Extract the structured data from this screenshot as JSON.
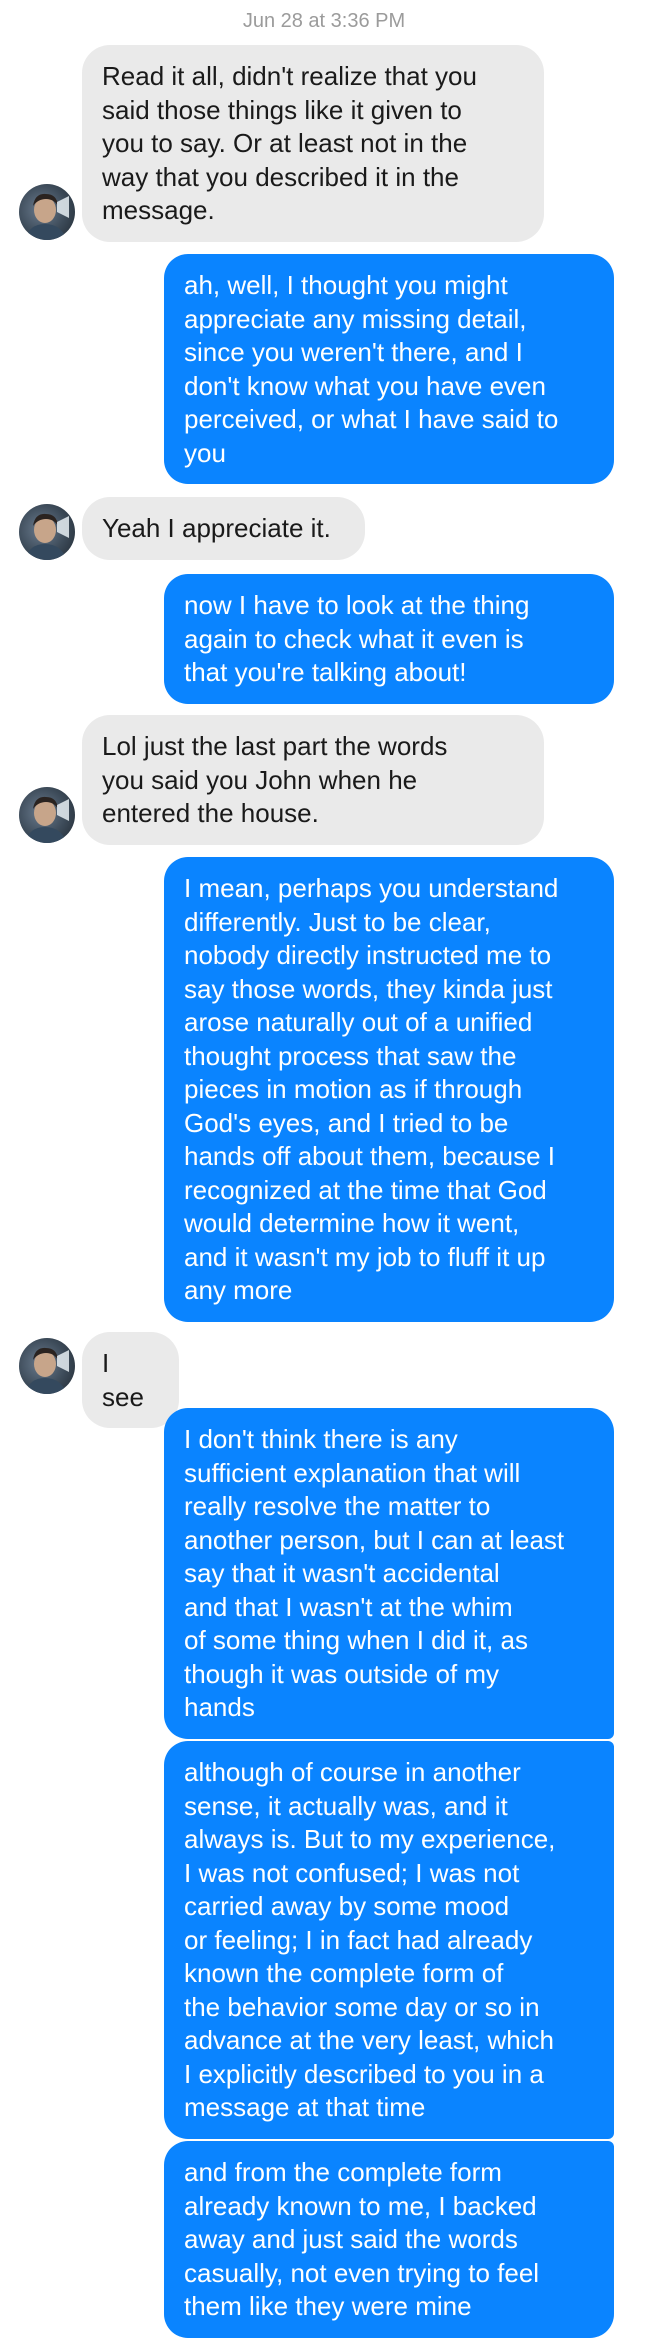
{
  "timestamp": "Jun 28 at 3:36 PM",
  "contact": {
    "avatar_icon": "contact-avatar-photo"
  },
  "colors": {
    "outgoing": "#0a84ff",
    "incoming": "#eaeaea",
    "timestamp": "#9b9b9b"
  },
  "messages": [
    {
      "direction": "incoming",
      "text": "Read it all, didn't realize that you\nsaid those things like it given to\nyou to say. Or at least not in the\nway that you described it in the\nmessage."
    },
    {
      "direction": "outgoing",
      "text": "ah, well, I thought you might\nappreciate any missing detail,\nsince you weren't there, and I\ndon't know what you have even\nperceived, or what I have said to\nyou"
    },
    {
      "direction": "incoming",
      "text": "Yeah I appreciate it."
    },
    {
      "direction": "outgoing",
      "text": "now I have to look at the thing\nagain to check what it even is\nthat you're talking about!"
    },
    {
      "direction": "incoming",
      "text": "Lol just the last part the words\nyou said you John when he\nentered the house."
    },
    {
      "direction": "outgoing",
      "text": "I mean, perhaps you understand\ndifferently. Just to be clear,\nnobody directly instructed me to\nsay those words, they kinda just\narose naturally out of a unified\nthought process that saw the\npieces in motion as if through\nGod's eyes, and I tried to be\nhands off about them, because I\nrecognized at the time that God\nwould determine how it went,\nand it wasn't my job to fluff it up\nany more"
    },
    {
      "direction": "incoming",
      "text": "I see"
    },
    {
      "direction": "outgoing",
      "text": "I don't think there is any\nsufficient explanation that will\nreally resolve the matter to\nanother person, but I can at least\nsay that it wasn't accidental\nand that I wasn't at the whim\nof some thing when I did it, as\nthough it was outside of my\nhands"
    },
    {
      "direction": "outgoing",
      "text": "although of course in another\nsense, it actually was, and it\nalways is. But to my experience,\nI was not confused; I was not\ncarried away by some mood\nor feeling; I in fact had already\nknown the complete form of\nthe behavior some day or so in\nadvance at the very least, which\nI explicitly described to you in a\nmessage at that time"
    },
    {
      "direction": "outgoing",
      "text": "and from the complete form\nalready known to me, I backed\naway and just said the words\ncasually, not even trying to feel\nthem like they were mine"
    }
  ]
}
